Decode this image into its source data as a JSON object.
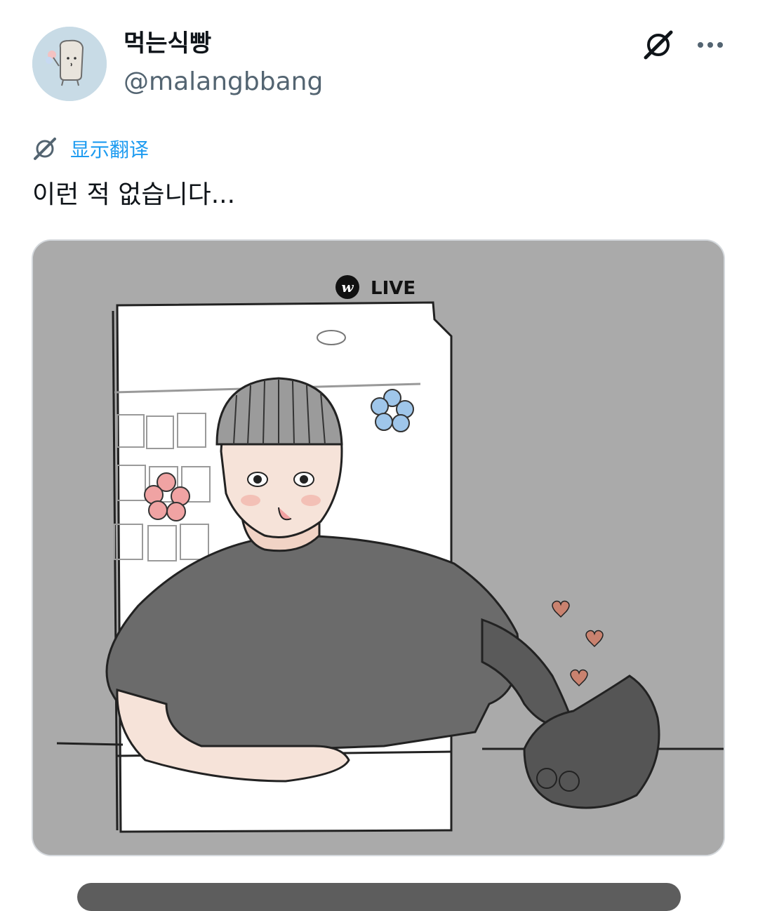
{
  "author": {
    "display_name": "먹는식빵",
    "handle": "@malangbbang"
  },
  "actions": {
    "top_icon": "grok-icon",
    "more_icon": "more-horizontal-icon"
  },
  "translate": {
    "icon": "grok-icon",
    "label": "显示翻译"
  },
  "tweet": {
    "text": "이런 적 없습니다..."
  },
  "media": {
    "badge_text": "LIVE",
    "badge_logo": "w",
    "description_icon": "illustration"
  },
  "colors": {
    "link": "#1d9bf0",
    "secondary_text": "#536471",
    "media_background": "#aaaaaa"
  }
}
